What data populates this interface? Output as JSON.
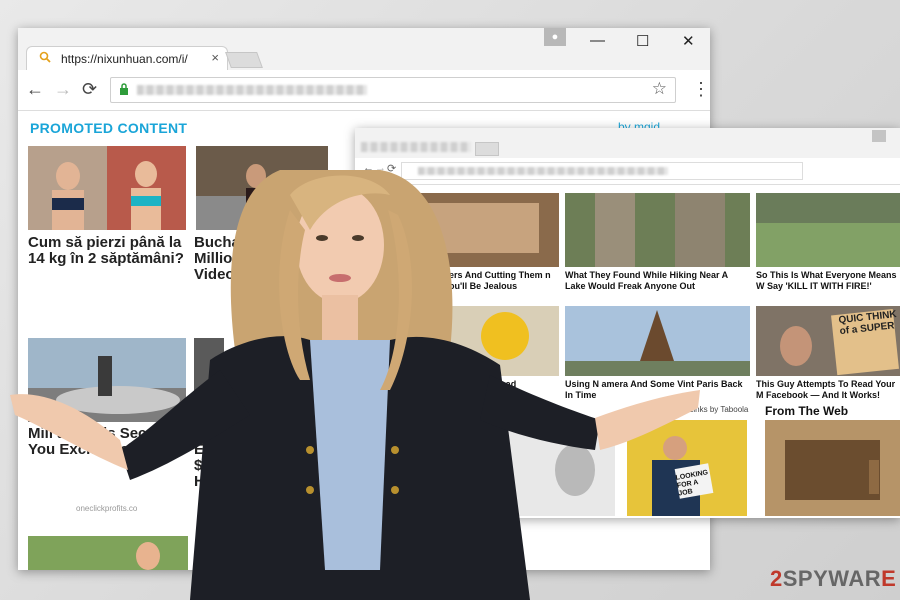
{
  "browser_back": {
    "tab_title": "https://nixunhuan.com/i/",
    "tab_close": "×",
    "window_controls": {
      "minimize": "—",
      "maximize": "☐",
      "close": "✕"
    },
    "nav": {
      "back": "←",
      "forward": "→",
      "reload": "⟳",
      "star": "☆",
      "menu": "⋮"
    },
    "promoted_label": "PROMOTED CONTENT",
    "brand_partial": "by mgid",
    "captions": [
      "Cum să pierzi până la 14 kg în 2 săptămâni?",
      "Bucharest Millionaire This Video Deleted",
      "Mill ares His Secret You Exclusively",
      "H Ea $1 H"
    ],
    "watermark": "oneclickprofits.co"
  },
  "browser_front": {
    "ad_captions": [
      "ed Tracing Letters And Cutting Them n You See Why You'll Be Jealous",
      "What They Found While Hiking Near A Lake Would Freak Anyone Out",
      "So This Is What Everyone Means W Say 'KILL IT WITH FIRE!'",
      "king Cooling Rack r Your Head",
      "Using N amera And Some Vint Paris Back In Time",
      "This Guy Attempts To Read Your M Facebook — And It Works!"
    ],
    "sponsored": "Sponsored Links by Taboola",
    "from_the_web": "From The Web",
    "sign_text": "QUIC THINK of a SUPER",
    "looking_sign": "LOOKING FOR A JOB"
  },
  "colors": {
    "accent": "#1aa5d8",
    "logo_red": "#c0392b"
  },
  "logo": {
    "two": "2",
    "rest": "SPYWAR",
    "tail": "E"
  }
}
